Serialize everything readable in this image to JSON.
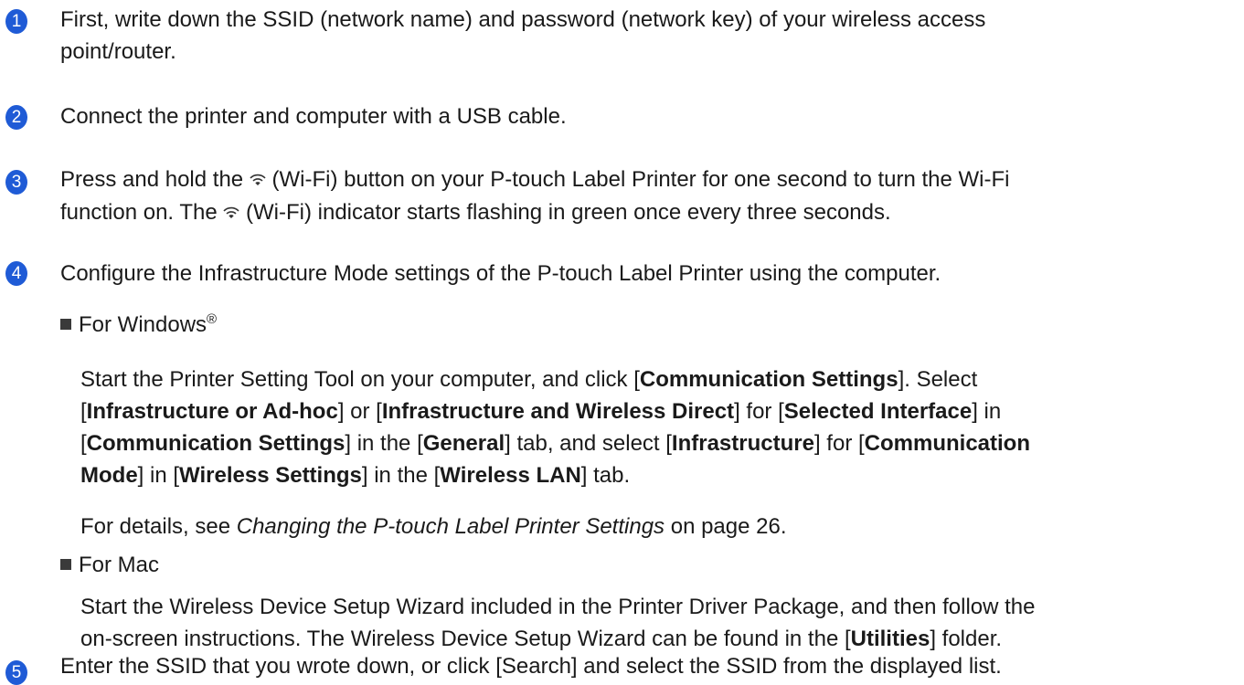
{
  "colors": {
    "step_badge": "#1f5bd6"
  },
  "steps": [
    {
      "num": "1",
      "lines": [
        "First, write down the SSID (network name) and password (network key) of your wireless access",
        "point/router."
      ]
    },
    {
      "num": "2",
      "lines": [
        "Connect the printer and computer with a USB cable."
      ]
    },
    {
      "num": "3",
      "line1_a": "Press and hold the ",
      "line1_b": " (Wi-Fi) button on your P-touch Label Printer for one second to turn the Wi-Fi",
      "line2_a": "function on. The ",
      "line2_b": " (Wi-Fi) indicator starts flashing in green once every three seconds.",
      "icon": "wifi-icon"
    },
    {
      "num": "4",
      "lines": [
        "Configure the Infrastructure Mode settings of the P-touch Label Printer using the computer."
      ]
    },
    {
      "num": "5",
      "lines": [
        "Enter the SSID that you wrote down, or click [Search] and select the SSID from the displayed list."
      ]
    }
  ],
  "windows": {
    "bullet": "For Windows",
    "reg": "®",
    "l1_a": "Start the Printer Setting Tool on your computer, and click [",
    "l1_b": "Communication Settings",
    "l1_c": "]. Select",
    "l2_a": "[",
    "l2_b": "Infrastructure or Ad-hoc",
    "l2_c": "] or [",
    "l2_d": "Infrastructure and Wireless Direct",
    "l2_e": "] for [",
    "l2_f": "Selected Interface",
    "l2_g": "] in",
    "l3_a": "[",
    "l3_b": "Communication Settings",
    "l3_c": "] in the [",
    "l3_d": "General",
    "l3_e": "] tab, and select [",
    "l3_f": "Infrastructure",
    "l3_g": "] for [",
    "l3_h": "Communication",
    "l4_a": "Mode",
    "l4_b": "] in [",
    "l4_c": "Wireless Settings",
    "l4_d": "] in the [",
    "l4_e": "Wireless LAN",
    "l4_f": "] tab.",
    "details_a": "For details, see ",
    "details_link": "Changing the P-touch Label Printer Settings",
    "details_b": " on page 26."
  },
  "mac": {
    "bullet": "For Mac",
    "l1": "Start the Wireless Device Setup Wizard included in the Printer Driver Package, and then follow the",
    "l2_a": "on-screen instructions. The Wireless Device Setup Wizard can be found in the [",
    "l2_b": "Utilities",
    "l2_c": "] folder."
  }
}
